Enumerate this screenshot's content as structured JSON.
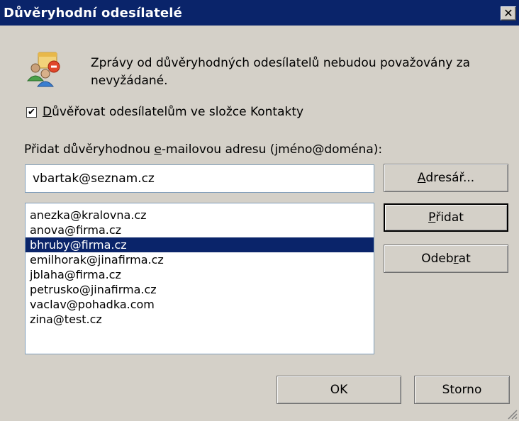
{
  "window": {
    "title": "Důvěryhodní odesílatelé",
    "close_glyph": "✕"
  },
  "icon": "trusted-senders-icon",
  "message": "Zprávy od důvěryhodných odesílatelů nebudou považovány za nevyžádané.",
  "trust_contacts": {
    "pre": "",
    "accel": "D",
    "post": "ůvěřovat odesílatelům ve složce Kontakty",
    "checked": true,
    "check_glyph": "✔"
  },
  "add_label": {
    "pre": "Přidat důvěryhodnou ",
    "accel": "e",
    "post": "-mailovou adresu (jméno@doména):"
  },
  "address_input": {
    "value": "vbartak@seznam.cz"
  },
  "buttons": {
    "address_book": {
      "pre": "",
      "accel": "A",
      "post": "dresář..."
    },
    "add": {
      "pre": "",
      "accel": "P",
      "post": "řidat"
    },
    "remove": {
      "pre": "Odeb",
      "accel": "r",
      "post": "at"
    },
    "ok": "OK",
    "cancel": "Storno"
  },
  "list": {
    "items": [
      "anezka@kralovna.cz",
      "anova@firma.cz",
      "bhruby@firma.cz",
      "emilhorak@jinafirma.cz",
      "jblaha@firma.cz",
      "petrusko@jinafirma.cz",
      "vaclav@pohadka.com",
      "zina@test.cz"
    ],
    "selected_index": 2
  },
  "colors": {
    "titlebar": "#0a246a",
    "selection": "#0a246a",
    "dialog": "#d4d0c8"
  }
}
